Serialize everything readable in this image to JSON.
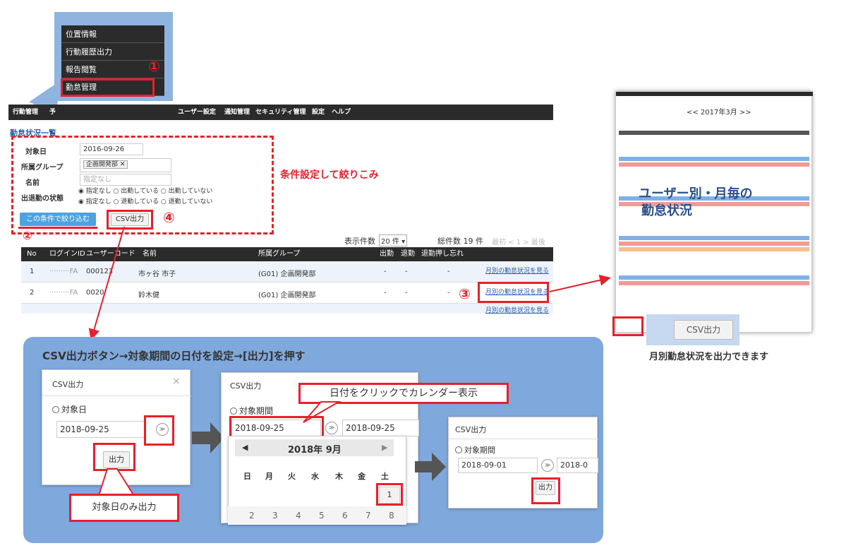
{
  "menu": {
    "items": [
      "位置情報",
      "行動履歴出力",
      "報告閲覧",
      "勤怠管理"
    ]
  },
  "markers": {
    "m1": "①",
    "m2": "②",
    "m3": "③",
    "m4": "④"
  },
  "navbar": {
    "items": [
      "行動管理",
      "予",
      "ユーザー設定",
      "通知管理",
      "セキュリティ管理",
      "設定",
      "ヘルプ"
    ]
  },
  "page": {
    "title": "勤怠状況一覧",
    "filter_note": "条件設定して絞りこみ",
    "target_date_label": "対象日",
    "target_date_value": "2016-09-26",
    "group_label": "所属グループ",
    "group_value": "企画開発部 ✕",
    "name_label": "名前",
    "name_placeholder": "指定なし",
    "status_label": "出退勤の状態",
    "status_row1": "◉ 指定なし ○ 出勤している ○ 出勤していない",
    "status_row2": "◉ 指定なし ○ 退勤している ○ 退勤していない",
    "filter_button": "この条件で絞り込む",
    "csv_button": "CSV出力",
    "display_count_label": "表示件数",
    "display_count_value": "20 件 ▾",
    "total_label": "総件数 19 件",
    "pager": "最初 < 1 > 最後"
  },
  "table": {
    "headers": [
      "No",
      "ログインID",
      "ユーザーコード",
      "名前",
      "所属グループ",
      "出勤",
      "退勤",
      "退勤押し忘れ"
    ],
    "rows": [
      {
        "no": "1",
        "login": "·········FA",
        "code": "000123",
        "name": "市ヶ谷 市子",
        "group": "(G01) 企画開発部",
        "in": "-",
        "out": "-",
        "forgot": "-",
        "link": "月別の勤怠状況を見る"
      },
      {
        "no": "2",
        "login": "·········FA",
        "code": "0020",
        "name": "鈴木健",
        "group": "(G01) 企画開発部",
        "in": "-",
        "out": "-",
        "forgot": "-",
        "link": "月別の勤怠状況を見る"
      },
      {
        "no": "3",
        "login": "",
        "code": "",
        "name": "",
        "group": "",
        "in": "",
        "out": "",
        "forgot": "",
        "link": "月別の勤怠状況を見る"
      }
    ]
  },
  "right_panel": {
    "month": "<<  2017年3月  >>",
    "overlay_line1": "ユーザー別・月毎の",
    "overlay_line2": "勤怠状況",
    "csv_button": "CSV出力",
    "caption": "月別勤怠状況を出力できます"
  },
  "bottom": {
    "heading": "CSV出力ボタン→対象期間の日付を設定→[出力]を押す",
    "dialog1": {
      "title": "CSV出力",
      "close": "×",
      "label": "対象日",
      "date": "2018-09-25",
      "go": "≫",
      "button": "出力"
    },
    "callout1": "対象日のみ出力",
    "dialog2": {
      "title": "CSV出力",
      "label": "対象期間",
      "date_from": "2018-09-25",
      "date_to": "2018-09-25",
      "go": "≫"
    },
    "callout2": "日付をクリックでカレンダー表示",
    "calendar": {
      "month": "2018年 9月",
      "weekdays": [
        "日",
        "月",
        "火",
        "水",
        "木",
        "金",
        "土"
      ],
      "first_day": "1",
      "next_days": [
        "2",
        "3",
        "4",
        "5",
        "6",
        "7",
        "8"
      ]
    },
    "dialog3": {
      "title": "CSV出力",
      "label": "対象期間",
      "date_from": "2018-09-01",
      "date_to": "2018-0",
      "go": "≫",
      "button": "出力"
    }
  },
  "colors": {
    "accent_red": "#e8202a",
    "nav_dark": "#2b2b2b",
    "panel_blue": "#7fa8dd",
    "link_blue": "#2a5da8"
  }
}
